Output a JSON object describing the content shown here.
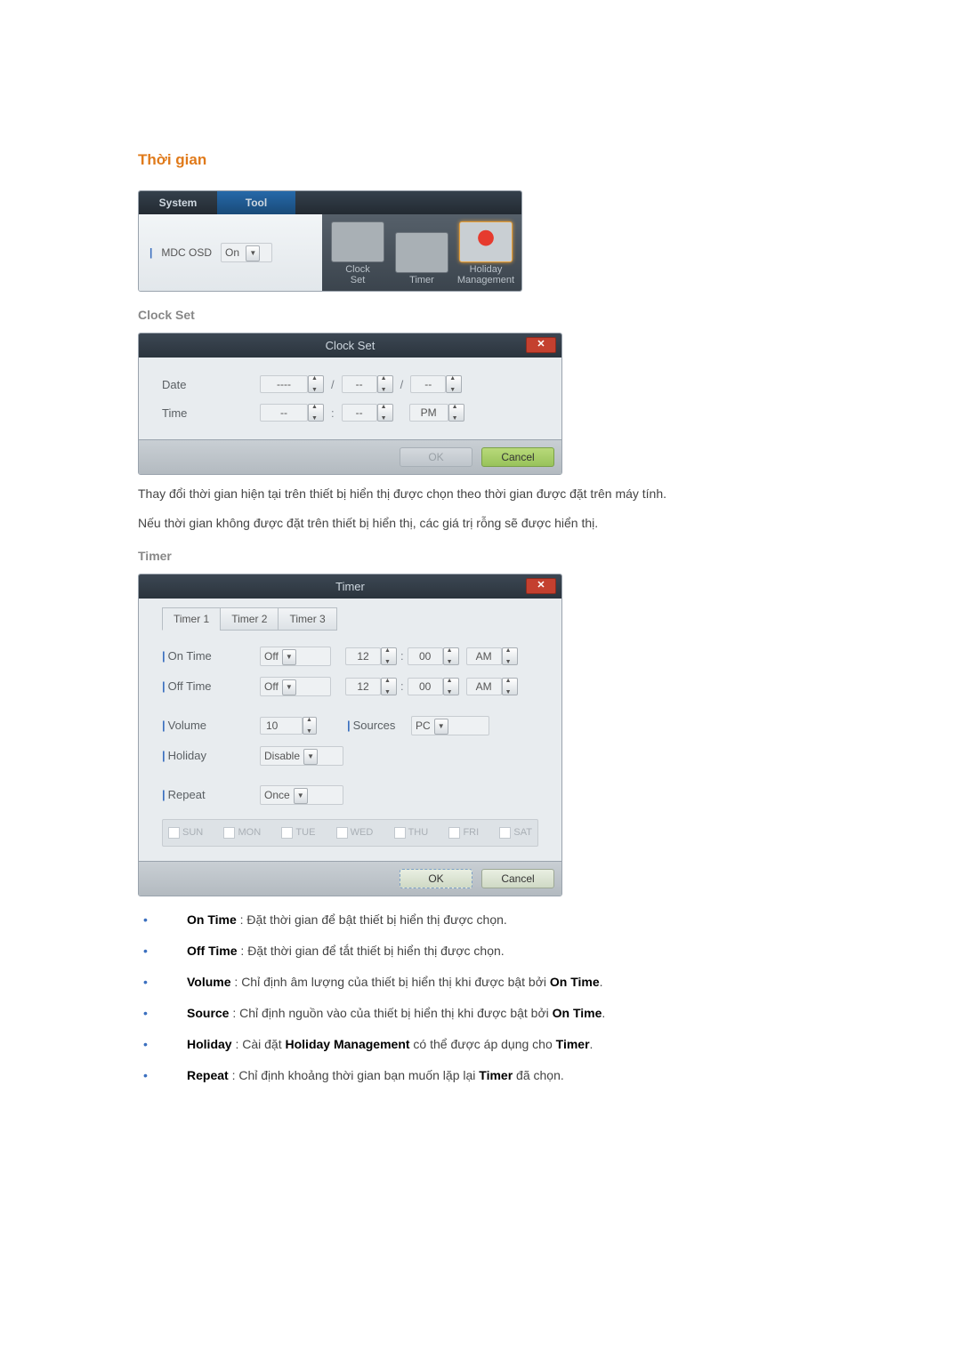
{
  "section_title": "Thời gian",
  "toolbar": {
    "tabs": [
      "System",
      "Tool"
    ],
    "mdc_label_bar": "|",
    "mdc_label": "MDC OSD",
    "mdc_value": "On",
    "items": [
      {
        "caption": "Clock\nSet"
      },
      {
        "caption": "Timer"
      },
      {
        "caption": "Holiday\nManagement"
      }
    ]
  },
  "cs": {
    "heading": "Clock Set",
    "title": "Clock Set",
    "date_label": "Date",
    "time_label": "Time",
    "year": "----",
    "month": "--",
    "day": "--",
    "hour": "--",
    "min": "--",
    "ampm": "PM",
    "sep_date": "/",
    "sep_time": ":",
    "ok": "OK",
    "cancel": "Cancel"
  },
  "cs_desc1": "Thay đổi thời gian hiện tại trên thiết bị hiển thị được chọn theo thời gian được đặt trên máy tính.",
  "cs_desc2": "Nếu thời gian không được đặt trên thiết bị hiển thị, các giá trị rỗng sẽ được hiển thị.",
  "tm": {
    "heading": "Timer",
    "title": "Timer",
    "tabs": [
      "Timer 1",
      "Timer 2",
      "Timer 3"
    ],
    "on_time_label": "On Time",
    "off_time_label": "Off Time",
    "volume_label": "Volume",
    "sources_label": "Sources",
    "holiday_label": "Holiday",
    "repeat_label": "Repeat",
    "on_off_val": "Off",
    "h": "12",
    "m": "00",
    "ampm": "AM",
    "sep": ":",
    "volume_val": "10",
    "sources_val": "PC",
    "holiday_val": "Disable",
    "repeat_val": "Once",
    "days": [
      "SUN",
      "MON",
      "TUE",
      "WED",
      "THU",
      "FRI",
      "SAT"
    ],
    "ok": "OK",
    "cancel": "Cancel"
  },
  "bullets": {
    "on_time": {
      "b": "On Time",
      "t": " : Đặt thời gian để bật thiết bị hiển thị được chọn."
    },
    "off_time": {
      "b": "Off Time",
      "t": " : Đặt thời gian để tắt thiết bị hiển thị được chọn."
    },
    "volume": {
      "b": "Volume",
      "t1": " : Chỉ định âm lượng của thiết bị hiển thị khi được bật bởi ",
      "b2": "On Time",
      "t2": "."
    },
    "source": {
      "b": "Source",
      "t1": " : Chỉ định nguồn vào của thiết bị hiển thị khi được bật bởi ",
      "b2": "On Time",
      "t2": "."
    },
    "holiday": {
      "b": "Holiday",
      "t1": " : Cài đặt ",
      "b2": "Holiday Management",
      "t2": " có thể được áp dụng cho ",
      "b3": "Timer",
      "t3": "."
    },
    "repeat": {
      "b": "Repeat",
      "t1": " : Chỉ định khoảng thời gian bạn muốn lặp lại ",
      "b2": "Timer",
      "t2": " đã chọn."
    }
  }
}
